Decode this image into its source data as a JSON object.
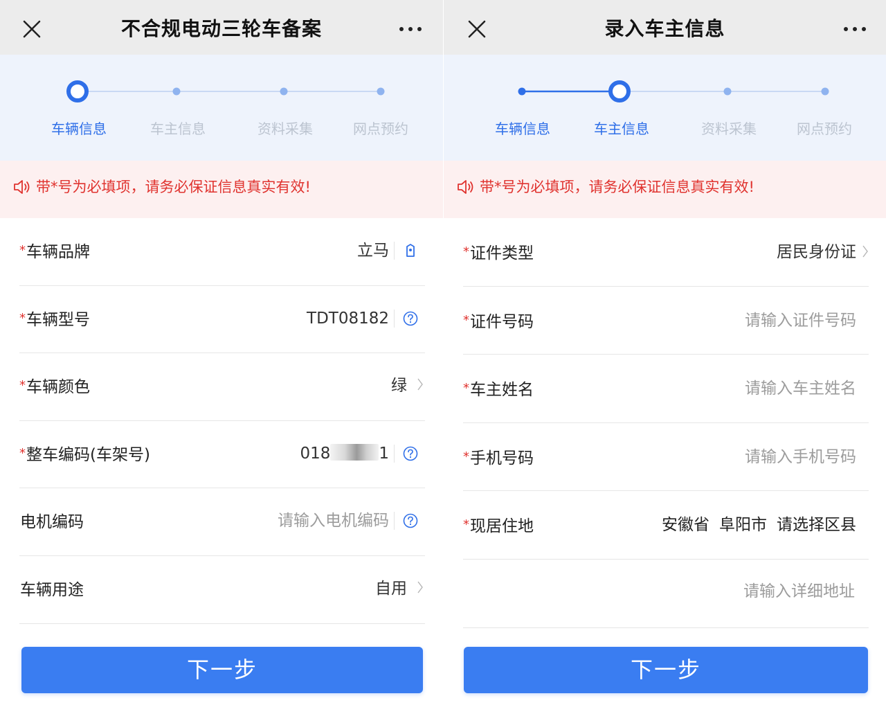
{
  "colors": {
    "accent": "#3a7df1",
    "step_active": "#2f6fe8",
    "warning": "#e0332f",
    "placeholder": "#9c9c9c"
  },
  "left": {
    "title": "不合规电动三轮车备案",
    "steps": [
      {
        "label": "车辆信息",
        "state": "current"
      },
      {
        "label": "车主信息",
        "state": "pending"
      },
      {
        "label": "资料采集",
        "state": "pending"
      },
      {
        "label": "网点预约",
        "state": "pending"
      }
    ],
    "notice": "带*号为必填项，请务必保证信息真实有效!",
    "fields": [
      {
        "label": "车辆品牌",
        "required": "*",
        "value": "立马",
        "icon": "tag-icon"
      },
      {
        "label": "车辆型号",
        "required": "*",
        "value": "TDT08182",
        "icon": "help-icon"
      },
      {
        "label": "车辆颜色",
        "required": "*",
        "value": "绿",
        "icon": "chevron-right-icon"
      },
      {
        "label": "整车编码(车架号)",
        "required": "*",
        "value_prefix": "018",
        "value_suffix": "1",
        "icon": "help-icon"
      },
      {
        "label": "电机编码",
        "required": "",
        "placeholder": "请输入电机编码",
        "icon": "help-icon"
      },
      {
        "label": "车辆用途",
        "required": "",
        "value": "自用",
        "icon": "chevron-right-icon"
      }
    ],
    "next_button": "下一步"
  },
  "right": {
    "title": "录入车主信息",
    "steps": [
      {
        "label": "车辆信息",
        "state": "done"
      },
      {
        "label": "车主信息",
        "state": "current"
      },
      {
        "label": "资料采集",
        "state": "pending"
      },
      {
        "label": "网点预约",
        "state": "pending"
      }
    ],
    "notice": "带*号为必填项，请务必保证信息真实有效!",
    "fields": [
      {
        "label": "证件类型",
        "required": "*",
        "value": "居民身份证",
        "icon": "chevron-right-icon"
      },
      {
        "label": "证件号码",
        "required": "*",
        "placeholder": "请输入证件号码"
      },
      {
        "label": "车主姓名",
        "required": "*",
        "placeholder": "请输入车主姓名"
      },
      {
        "label": "手机号码",
        "required": "*",
        "placeholder": "请输入手机号码"
      },
      {
        "label": "现居住地",
        "required": "*",
        "province": "安徽省",
        "city": "阜阳市",
        "district_placeholder": "请选择区县"
      },
      {
        "label": "",
        "required": "",
        "placeholder": "请输入详细地址"
      }
    ],
    "next_button": "下一步"
  }
}
